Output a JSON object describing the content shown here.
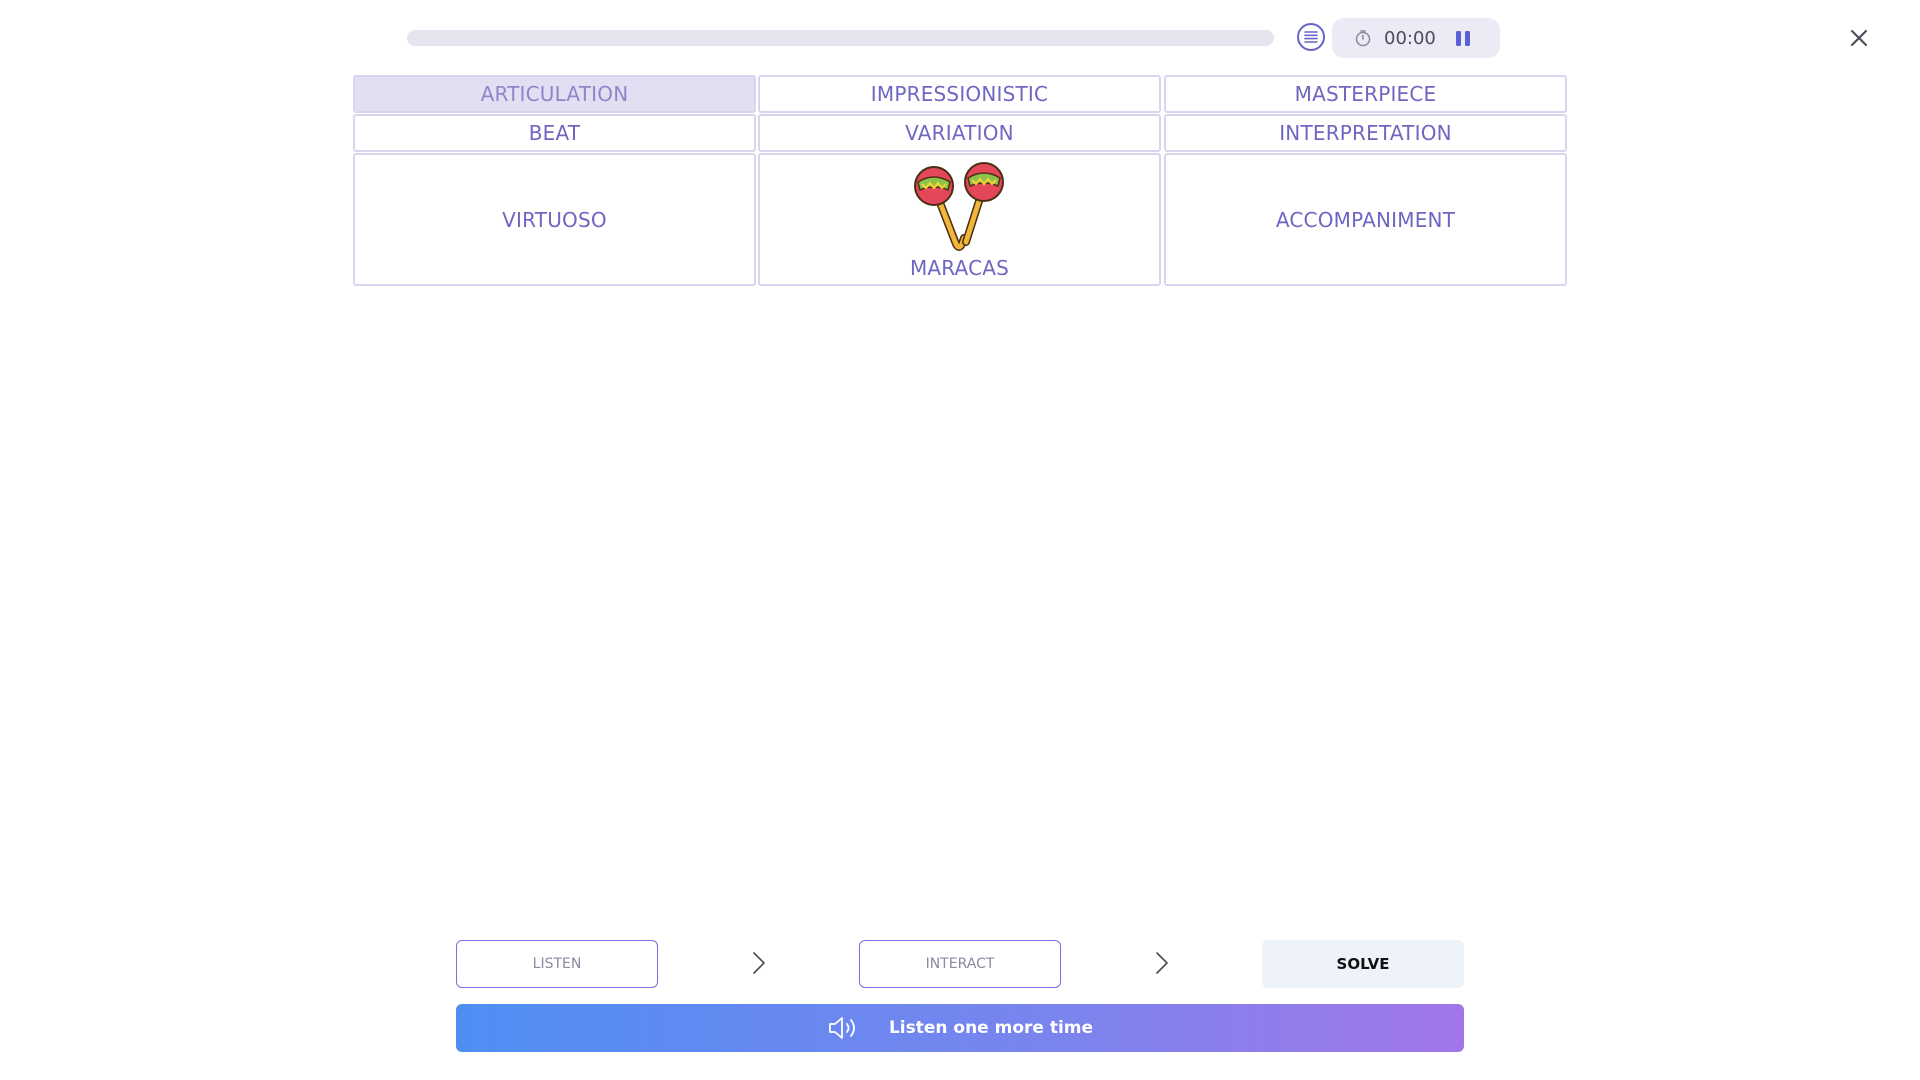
{
  "header": {
    "timer": "00:00",
    "progress": 0
  },
  "grid": {
    "row1": [
      "ARTICULATION",
      "IMPRESSIONISTIC",
      "MASTERPIECE"
    ],
    "row2": [
      "BEAT",
      "VARIATION",
      "INTERPRETATION"
    ],
    "row3": [
      "VIRTUOSO",
      "MARACAS",
      "ACCOMPANIMENT"
    ],
    "selected": "ARTICULATION",
    "image_icon": "maracas-icon"
  },
  "steps": {
    "listen": "LISTEN",
    "interact": "INTERACT",
    "solve": "SOLVE"
  },
  "listen_bar": {
    "label": "Listen one more time"
  },
  "colors": {
    "accent": "#6f66c2",
    "gradient_start": "#4e8ef3",
    "gradient_end": "#a276e9"
  }
}
